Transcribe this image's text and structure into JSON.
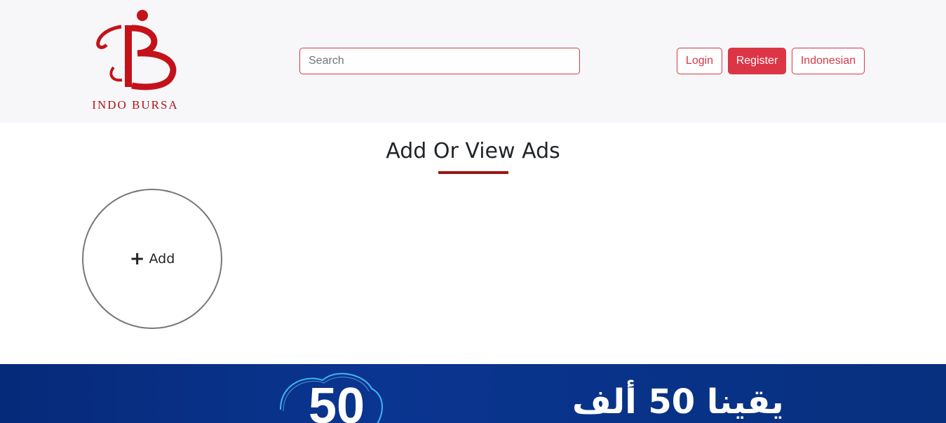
{
  "header": {
    "logo_text": "INDO BURSA",
    "search": {
      "placeholder": "Search",
      "value": ""
    },
    "buttons": {
      "login": "Login",
      "register": "Register",
      "language": "Indonesian"
    }
  },
  "main": {
    "title": "Add Or View Ads",
    "add_label": "Add"
  },
  "banner": {
    "number": "50",
    "text": "يقينا 50 ألف"
  },
  "colors": {
    "accent": "#dc3545",
    "logo_red": "#b01217",
    "banner_blue": "#0a3590"
  }
}
